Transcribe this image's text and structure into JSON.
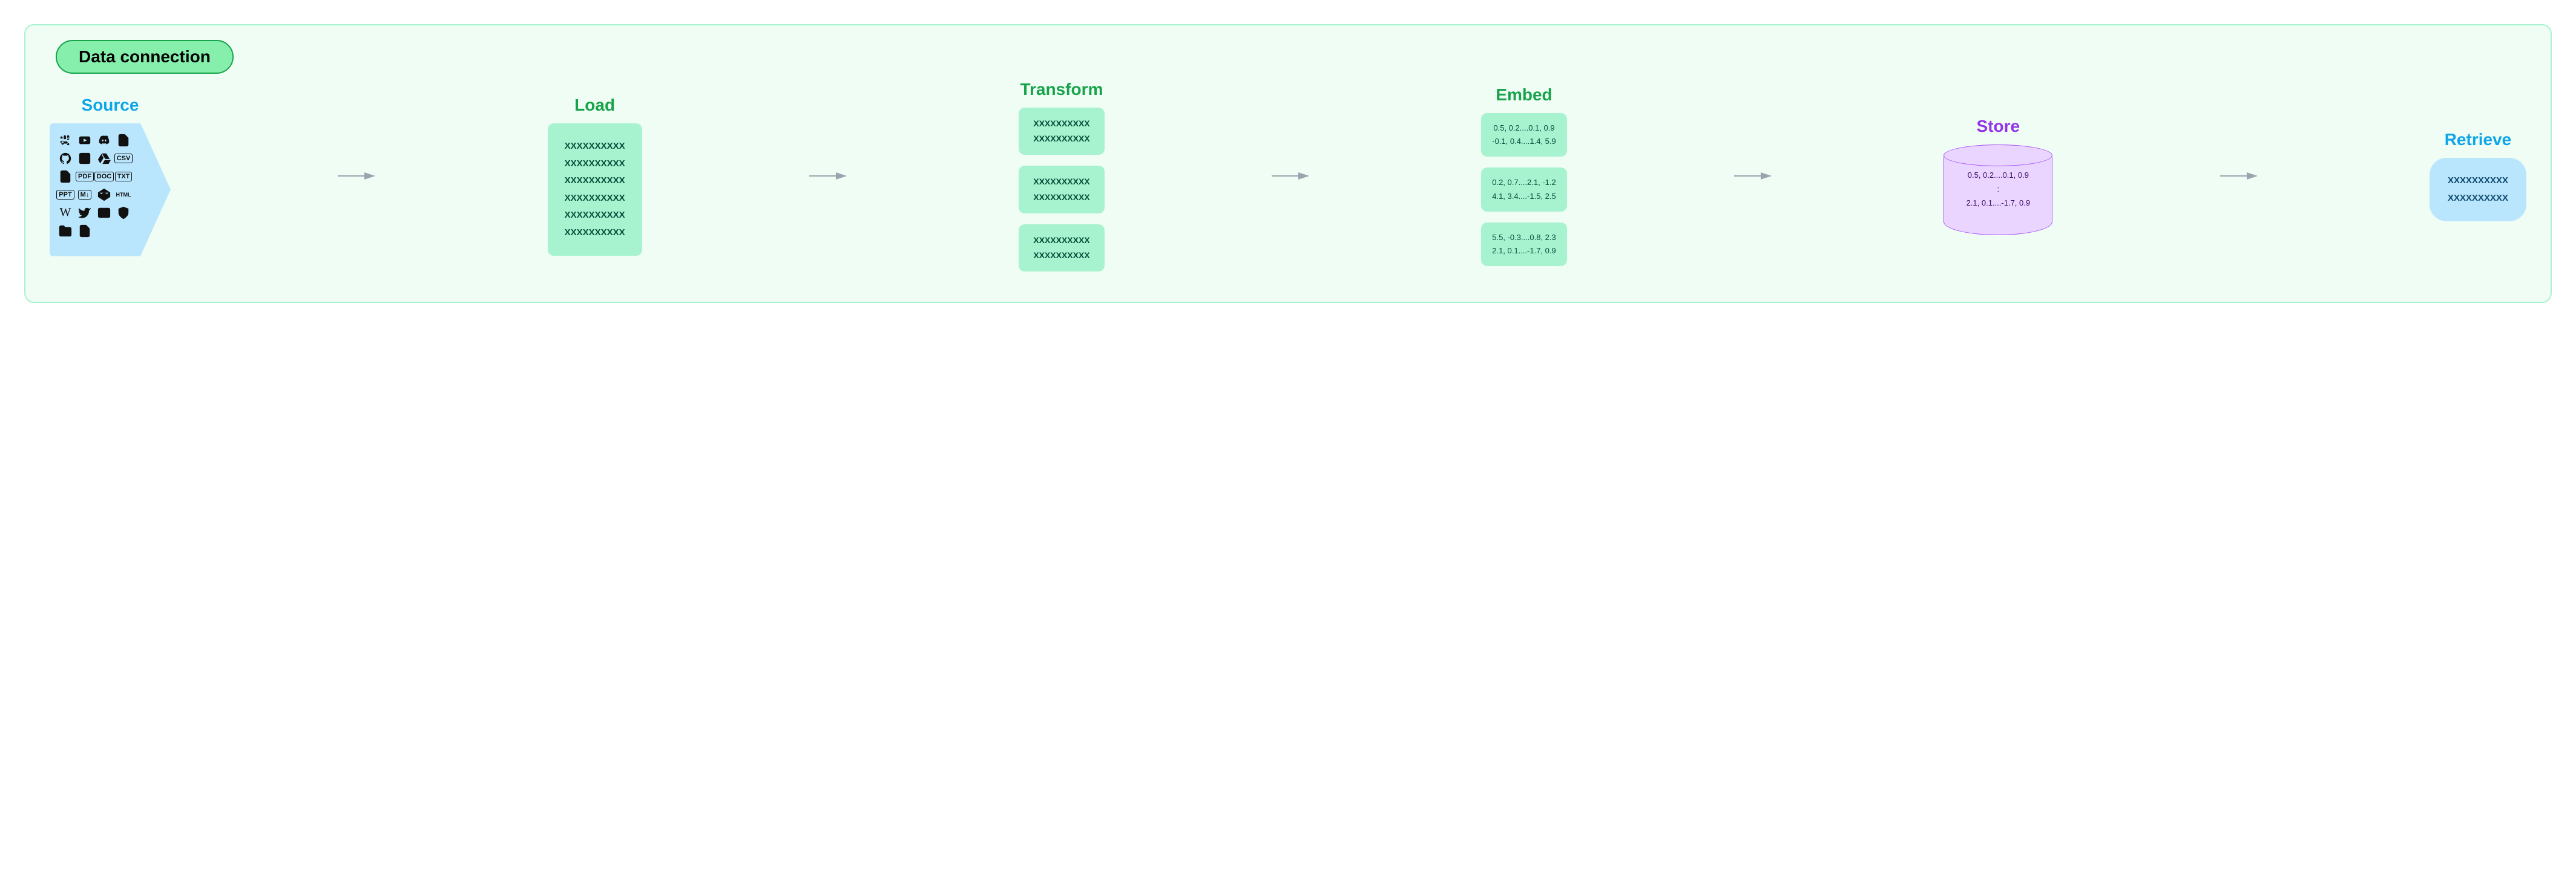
{
  "title": "Data connection",
  "stages": {
    "source": {
      "label": "Source"
    },
    "load": {
      "label": "Load",
      "lines": [
        "XXXXXXXXXX",
        "XXXXXXXXXX",
        "XXXXXXXXXX",
        "XXXXXXXXXX",
        "XXXXXXXXXX",
        "XXXXXXXXXX"
      ]
    },
    "transform": {
      "label": "Transform",
      "chunks": [
        [
          "XXXXXXXXXX",
          "XXXXXXXXXX"
        ],
        [
          "XXXXXXXXXX",
          "XXXXXXXXXX"
        ],
        [
          "XXXXXXXXXX",
          "XXXXXXXXXX"
        ]
      ]
    },
    "embed": {
      "label": "Embed",
      "vectors": [
        [
          "0.5, 0.2....0.1, 0.9",
          "-0.1, 0.4....1.4, 5.9"
        ],
        [
          "0.2, 0.7....2.1, -1.2",
          "4.1, 3.4....-1.5, 2.5"
        ],
        [
          "5.5, -0.3....0.8, 2.3",
          "2.1, 0.1....-1.7, 0.9"
        ]
      ]
    },
    "store": {
      "label": "Store",
      "lines": [
        "0.5, 0.2....0.1, 0.9",
        ":",
        "2.1, 0.1....-1.7, 0.9"
      ]
    },
    "retrieve": {
      "label": "Retrieve",
      "lines": [
        "XXXXXXXXXX",
        "XXXXXXXXXX"
      ]
    }
  },
  "source_icons": [
    "slack",
    "youtube",
    "discord",
    "file",
    "github",
    "image",
    "gdrive",
    "csv",
    "doc",
    "pdf",
    "doc2",
    "txt",
    "ppt",
    "md",
    "codepen",
    "html",
    "wikipedia",
    "twitter",
    "mail",
    "shield",
    "folder",
    "file2"
  ]
}
